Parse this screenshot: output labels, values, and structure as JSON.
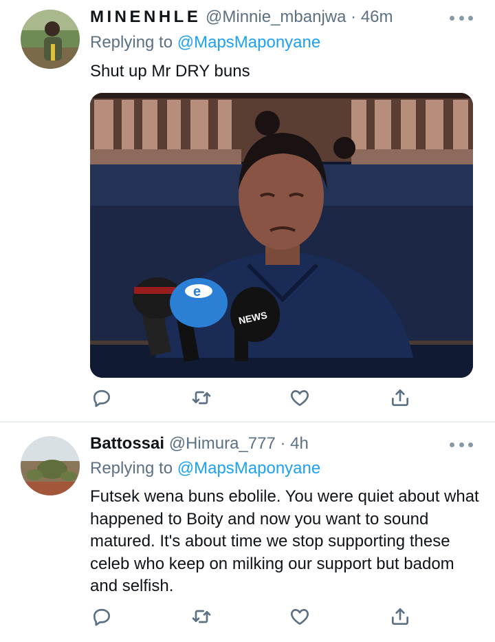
{
  "tweets": [
    {
      "display_name": "MINENHLE",
      "handle": "@Minnie_mbanjwa",
      "separator": "·",
      "time": "46m",
      "replying_prefix": "Replying to ",
      "replying_to": "@MapsMaponyane",
      "text": "Shut up Mr DRY buns",
      "media": {
        "mic_labels": [
          "e",
          "NEWS"
        ]
      }
    },
    {
      "display_name": "Battossai",
      "handle": "@Himura_777",
      "separator": "·",
      "time": "4h",
      "replying_prefix": "Replying to ",
      "replying_to": "@MapsMaponyane",
      "text": "Futsek wena buns ebolile. You were quiet about what happened to Boity and now you want to sound matured. It's about time we stop supporting these celeb who keep on milking our support but badom and selfish."
    }
  ],
  "icons": [
    "more-icon",
    "reply-icon",
    "retweet-icon",
    "like-icon",
    "share-icon"
  ],
  "colors": {
    "link": "#1da1f2",
    "secondary_text": "#5b7083",
    "primary_text": "#0f1419",
    "divider": "#e6ecf0"
  }
}
